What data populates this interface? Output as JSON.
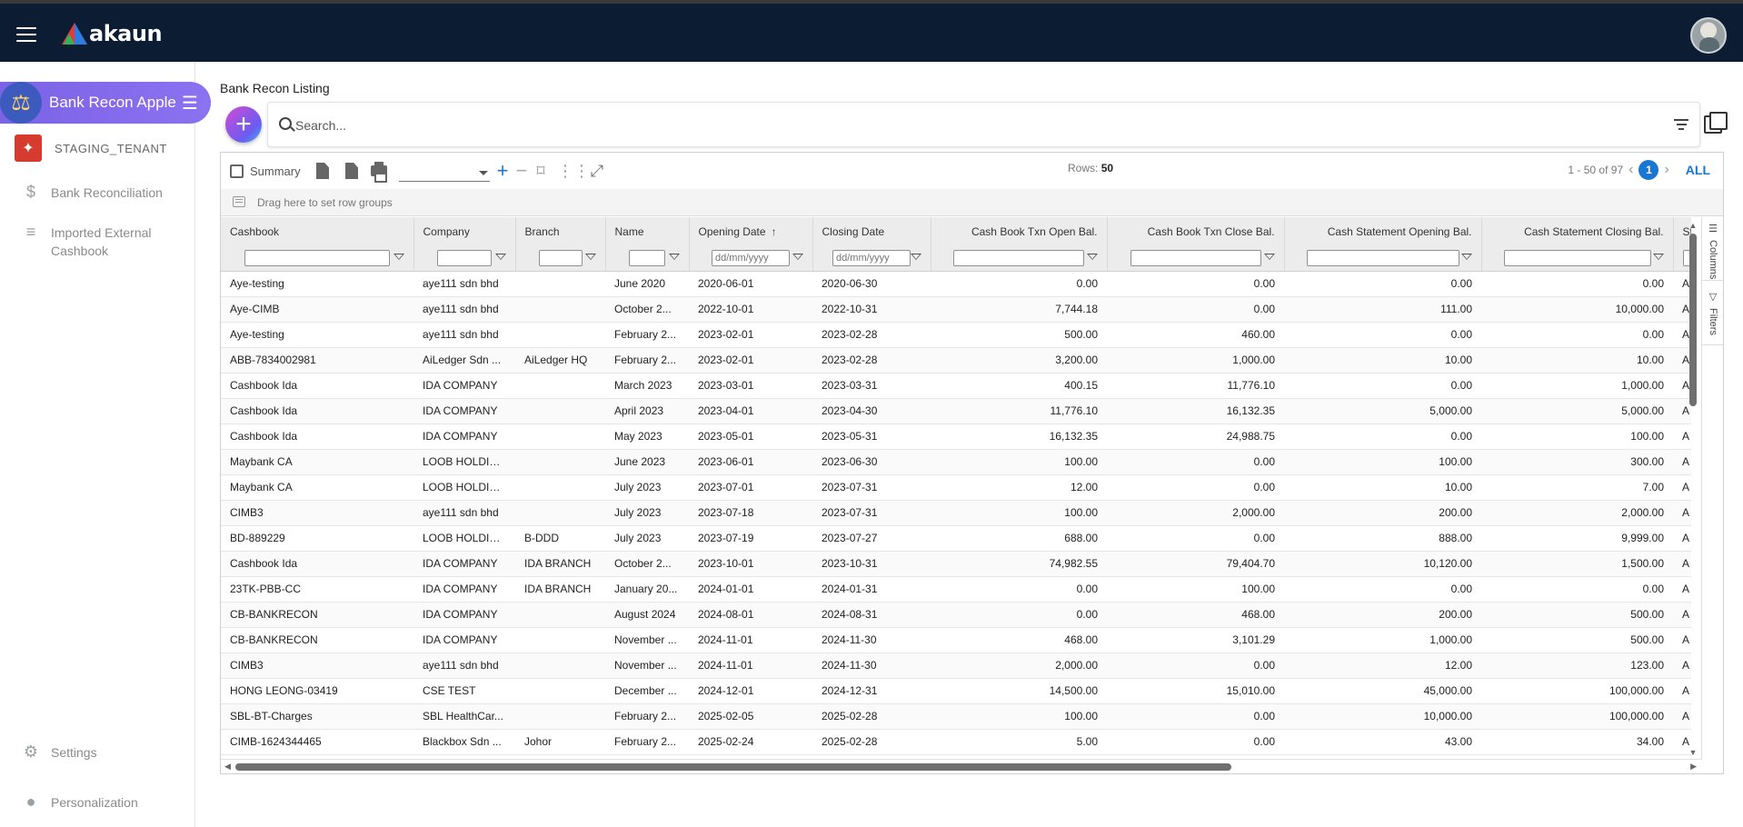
{
  "brand": {
    "name": "akaun"
  },
  "sidebar": {
    "app_name": "Bank Recon Apple",
    "tenant": "STAGING_TENANT",
    "items": [
      {
        "label": "Bank Reconciliation",
        "icon": "dollar-icon"
      },
      {
        "label": "Imported External Cashbook",
        "icon": "playlist-add-icon"
      }
    ],
    "bottom": [
      {
        "label": "Settings",
        "icon": "gear-icon"
      },
      {
        "label": "Personalization",
        "icon": "person-icon"
      }
    ]
  },
  "page": {
    "title": "Bank Recon Listing",
    "search_placeholder": "Search..."
  },
  "toolbar": {
    "summary_label": "Summary",
    "rows_label": "Rows:",
    "rows_value": "50",
    "range": "1 - 50 of 97",
    "current_page": "1",
    "all_label": "ALL"
  },
  "groupbar": {
    "text": "Drag here to set row groups"
  },
  "grid": {
    "columns": [
      "Cashbook",
      "Company",
      "Branch",
      "Name",
      "Opening Date",
      "Closing Date",
      "Cash Book Txn Open Bal.",
      "Cash Book Txn Close Bal.",
      "Cash Statement Opening Bal.",
      "Cash Statement Closing Bal.",
      "Stat"
    ],
    "date_placeholder": "dd/mm/yyyy",
    "rows": [
      [
        "Aye-testing",
        "aye111 sdn bhd",
        "",
        "June 2020",
        "2020-06-01",
        "2020-06-30",
        "0.00",
        "0.00",
        "0.00",
        "0.00",
        "A"
      ],
      [
        "Aye-CIMB",
        "aye111 sdn bhd",
        "",
        "October 2...",
        "2022-10-01",
        "2022-10-31",
        "7,744.18",
        "0.00",
        "111.00",
        "10,000.00",
        "A"
      ],
      [
        "Aye-testing",
        "aye111 sdn bhd",
        "",
        "February 2...",
        "2023-02-01",
        "2023-02-28",
        "500.00",
        "460.00",
        "0.00",
        "0.00",
        "A"
      ],
      [
        "ABB-7834002981",
        "AiLedger Sdn ...",
        "AiLedger HQ",
        "February 2...",
        "2023-02-01",
        "2023-02-28",
        "3,200.00",
        "1,000.00",
        "10.00",
        "10.00",
        "A"
      ],
      [
        "Cashbook Ida",
        "IDA COMPANY",
        "",
        "March 2023",
        "2023-03-01",
        "2023-03-31",
        "400.15",
        "11,776.10",
        "0.00",
        "1,000.00",
        "A"
      ],
      [
        "Cashbook Ida",
        "IDA COMPANY",
        "",
        "April 2023",
        "2023-04-01",
        "2023-04-30",
        "11,776.10",
        "16,132.35",
        "5,000.00",
        "5,000.00",
        "A"
      ],
      [
        "Cashbook Ida",
        "IDA COMPANY",
        "",
        "May 2023",
        "2023-05-01",
        "2023-05-31",
        "16,132.35",
        "24,988.75",
        "0.00",
        "100.00",
        "A"
      ],
      [
        "Maybank CA",
        "LOOB HOLDIN...",
        "",
        "June 2023",
        "2023-06-01",
        "2023-06-30",
        "100.00",
        "0.00",
        "100.00",
        "300.00",
        "A"
      ],
      [
        "Maybank CA",
        "LOOB HOLDIN...",
        "",
        "July 2023",
        "2023-07-01",
        "2023-07-31",
        "12.00",
        "0.00",
        "10.00",
        "7.00",
        "A"
      ],
      [
        "CIMB3",
        "aye111 sdn bhd",
        "",
        "July 2023",
        "2023-07-18",
        "2023-07-31",
        "100.00",
        "2,000.00",
        "200.00",
        "2,000.00",
        "A"
      ],
      [
        "BD-889229",
        "LOOB HOLDIN...",
        "B-DDD",
        "July 2023",
        "2023-07-19",
        "2023-07-27",
        "688.00",
        "0.00",
        "888.00",
        "9,999.00",
        "A"
      ],
      [
        "Cashbook Ida",
        "IDA COMPANY",
        "IDA BRANCH",
        "October 2...",
        "2023-10-01",
        "2023-10-31",
        "74,982.55",
        "79,404.70",
        "10,120.00",
        "1,500.00",
        "A"
      ],
      [
        "23TK-PBB-CC",
        "IDA COMPANY",
        "IDA BRANCH",
        "January 20...",
        "2024-01-01",
        "2024-01-31",
        "0.00",
        "100.00",
        "0.00",
        "0.00",
        "A"
      ],
      [
        "CB-BANKRECON",
        "IDA COMPANY",
        "",
        "August 2024",
        "2024-08-01",
        "2024-08-31",
        "0.00",
        "468.00",
        "200.00",
        "500.00",
        "A"
      ],
      [
        "CB-BANKRECON",
        "IDA COMPANY",
        "",
        "November ...",
        "2024-11-01",
        "2024-11-30",
        "468.00",
        "3,101.29",
        "1,000.00",
        "500.00",
        "A"
      ],
      [
        "CIMB3",
        "aye111 sdn bhd",
        "",
        "November ...",
        "2024-11-01",
        "2024-11-30",
        "2,000.00",
        "0.00",
        "12.00",
        "123.00",
        "A"
      ],
      [
        "HONG LEONG-03419",
        "CSE TEST",
        "",
        "December ...",
        "2024-12-01",
        "2024-12-31",
        "14,500.00",
        "15,010.00",
        "45,000.00",
        "100,000.00",
        "A"
      ],
      [
        "SBL-BT-Charges",
        "SBL HealthCar...",
        "",
        "February 2...",
        "2025-02-05",
        "2025-02-28",
        "100.00",
        "0.00",
        "10,000.00",
        "100,000.00",
        "A"
      ],
      [
        "CIMB-1624344465",
        "Blackbox Sdn ...",
        "Johor",
        "February 2...",
        "2025-02-24",
        "2025-02-28",
        "5.00",
        "0.00",
        "43.00",
        "34.00",
        "A"
      ]
    ]
  },
  "side_tabs": {
    "columns": "Columns",
    "filters": "Filters"
  },
  "colors": {
    "topbar": "#0b1c33",
    "accent": "#1976d2",
    "app_pill": "#7b63e6"
  }
}
